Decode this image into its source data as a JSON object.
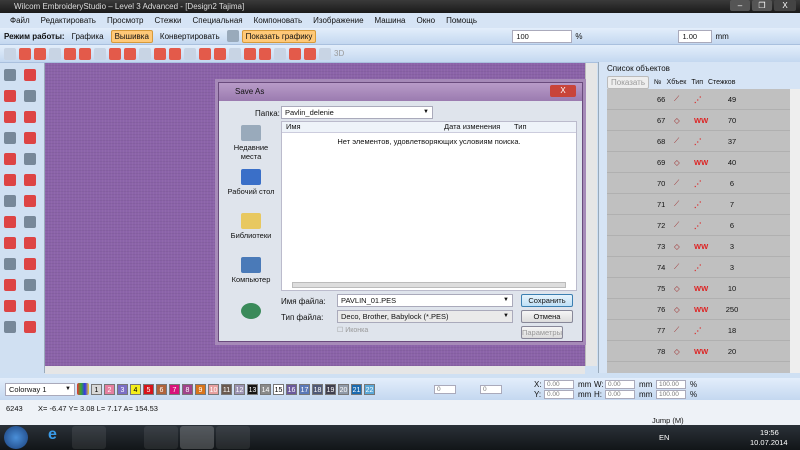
{
  "window": {
    "title": "Wilcom EmbroideryStudio – Level 3 Advanced - [Design2          Tajima]",
    "min": "–",
    "max": "❐",
    "close": "X"
  },
  "menu": [
    "Файл",
    "Редактировать",
    "Просмотр",
    "Стежки",
    "Специальная",
    "Компоновать",
    "Изображение",
    "Машина",
    "Окно",
    "Помощь"
  ],
  "toolbar": {
    "mode_label": "Режим работы:",
    "graphics": "Графика",
    "embroidery": "Вышивка",
    "convert": "Конвертировать",
    "show_graphics": "Показать графику",
    "zoom": "100",
    "zoom_unit": "%",
    "thickness": "1.00",
    "thickness_unit": "mm",
    "label_3d": "3D"
  },
  "dialog": {
    "title": "Save As",
    "close": "X",
    "folder_label": "Папка:",
    "folder": "Pavlin_delenie",
    "col_name": "Имя",
    "col_date": "Дата изменения",
    "col_type": "Тип",
    "empty_msg": "Нет элементов, удовлетворяющих условиям поиска.",
    "places": [
      "Недавние места",
      "Рабочий стол",
      "Библиотеки",
      "Компьютер"
    ],
    "filename_label": "Имя файла:",
    "filename": "PAVLIN_01.PES",
    "filetype_label": "Тип файла:",
    "filetype": "Deco, Brother, Babylock (*.PES)",
    "icon_checkbox": "Иконка",
    "save": "Сохранить",
    "cancel": "Отмена",
    "params": "Параметры"
  },
  "objects": {
    "title": "Список объектов",
    "show": "Показать",
    "col_no": "№",
    "col_obj": "Хбъек",
    "col_type": "Тип",
    "col_stitches": "Стежков",
    "rows": [
      {
        "no": "66",
        "stitches": "49",
        "kind": "run"
      },
      {
        "no": "67",
        "stitches": "70",
        "kind": "fill"
      },
      {
        "no": "68",
        "stitches": "37",
        "kind": "line"
      },
      {
        "no": "69",
        "stitches": "40",
        "kind": "fill"
      },
      {
        "no": "70",
        "stitches": "6",
        "kind": "line"
      },
      {
        "no": "71",
        "stitches": "7",
        "kind": "run"
      },
      {
        "no": "72",
        "stitches": "6",
        "kind": "line"
      },
      {
        "no": "73",
        "stitches": "3",
        "kind": "fill"
      },
      {
        "no": "74",
        "stitches": "3",
        "kind": "line"
      },
      {
        "no": "75",
        "stitches": "10",
        "kind": "fill"
      },
      {
        "no": "76",
        "stitches": "250",
        "kind": "fill"
      },
      {
        "no": "77",
        "stitches": "18",
        "kind": "run"
      },
      {
        "no": "78",
        "stitches": "20",
        "kind": "fill"
      }
    ]
  },
  "colorway": {
    "name": "Colorway 1",
    "swatches": [
      {
        "n": "1",
        "c": "#d8d8d8"
      },
      {
        "n": "2",
        "c": "#e57fa0"
      },
      {
        "n": "3",
        "c": "#7b6fc6"
      },
      {
        "n": "4",
        "c": "#f5ee1a"
      },
      {
        "n": "5",
        "c": "#d7141c"
      },
      {
        "n": "6",
        "c": "#b0643c"
      },
      {
        "n": "7",
        "c": "#d8127a"
      },
      {
        "n": "8",
        "c": "#a0438c"
      },
      {
        "n": "9",
        "c": "#d8751c"
      },
      {
        "n": "10",
        "c": "#e7a0a0"
      },
      {
        "n": "11",
        "c": "#6a5a50"
      },
      {
        "n": "12",
        "c": "#9b93b3"
      },
      {
        "n": "13",
        "c": "#151515"
      },
      {
        "n": "14",
        "c": "#8a8a8a"
      },
      {
        "n": "15",
        "c": "#ffffff"
      },
      {
        "n": "16",
        "c": "#6b5a9c"
      },
      {
        "n": "17",
        "c": "#5a78b8"
      },
      {
        "n": "18",
        "c": "#505a78"
      },
      {
        "n": "19",
        "c": "#404050"
      },
      {
        "n": "20",
        "c": "#909aa8"
      },
      {
        "n": "21",
        "c": "#1a6ab0"
      },
      {
        "n": "22",
        "c": "#5aa8d8"
      }
    ]
  },
  "transform": {
    "rot": "0",
    "slant": "0",
    "x_label": "X:",
    "x": "0.00",
    "y_label": "Y:",
    "y": "0.00",
    "w_label": "W:",
    "w": "0.00",
    "h_label": "H:",
    "h": "0.00",
    "unit": "mm",
    "sx": "100.00",
    "sy": "100.00",
    "pct": "%"
  },
  "status": {
    "count": "6243",
    "coords": "X=  -6.47 Y=   3.08 L=   7.17 A= 154.53",
    "mode": "Jump (M)"
  },
  "tray": {
    "lang": "EN",
    "time": "19:56",
    "date": "10.07.2014"
  }
}
